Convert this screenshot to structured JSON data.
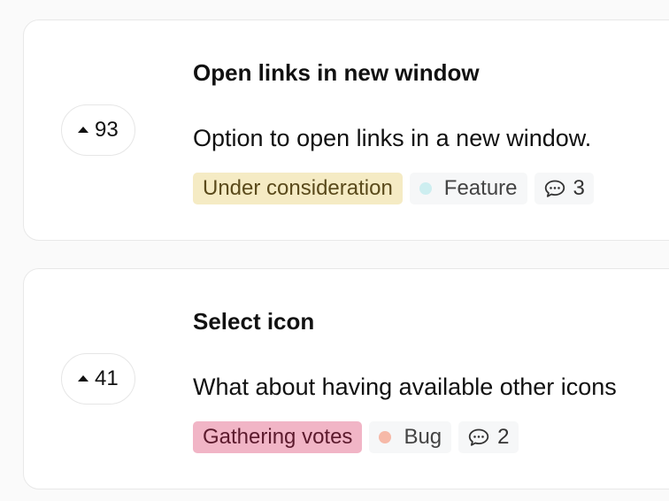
{
  "posts": [
    {
      "votes": "93",
      "title": "Open links in new window",
      "description": "Option to open links in a new window.",
      "status": "Under consideration",
      "category": {
        "name": "Feature",
        "dot_color": "#cdeef0"
      },
      "comments": "3"
    },
    {
      "votes": "41",
      "title": "Select icon",
      "description": "What about having available other icons",
      "status": "Gathering votes",
      "category": {
        "name": "Bug",
        "dot_color": "#f6b9a8"
      },
      "comments": "2"
    }
  ],
  "icons": {
    "upvote": "caret-up-icon",
    "comment": "comment-bubble-icon",
    "category": "category-dot-icon"
  },
  "colors": {
    "status_under_consideration_bg": "#f5ebc4",
    "status_gathering_votes_bg": "#f1b5c6"
  }
}
